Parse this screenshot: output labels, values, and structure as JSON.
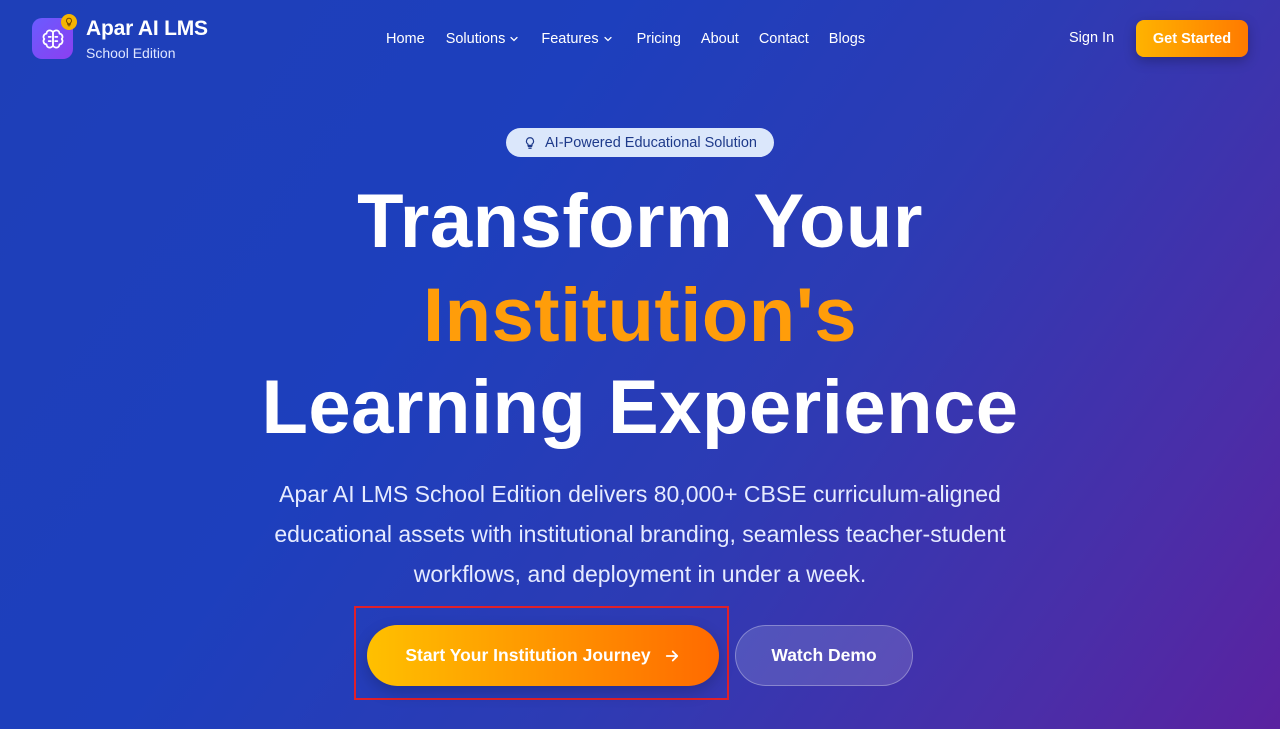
{
  "brand": {
    "title": "Apar AI LMS",
    "subtitle": "School Edition",
    "logo_icon": "brain-icon",
    "badge_icon": "bulb-icon"
  },
  "nav": {
    "items": [
      {
        "label": "Home",
        "has_dropdown": false
      },
      {
        "label": "Solutions",
        "has_dropdown": true
      },
      {
        "label": "Features",
        "has_dropdown": true
      },
      {
        "label": "Pricing",
        "has_dropdown": false
      },
      {
        "label": "About",
        "has_dropdown": false
      },
      {
        "label": "Contact",
        "has_dropdown": false
      },
      {
        "label": "Blogs",
        "has_dropdown": false
      }
    ],
    "sign_in": "Sign In",
    "get_started": "Get Started"
  },
  "hero": {
    "pill_text": "AI-Powered Educational Solution",
    "headline_1": "Transform Your",
    "headline_2": "Institution's",
    "headline_3": "Learning Experience",
    "description_line_1": "Apar AI LMS School Edition delivers 80,000+ CBSE curriculum-aligned",
    "description_line_2": "educational assets with institutional branding, seamless teacher-student",
    "description_line_3": "workflows, and deployment in under a week.",
    "cta_primary": "Start Your Institution Journey",
    "cta_secondary": "Watch Demo"
  },
  "colors": {
    "accent_orange": "#ff9d0a",
    "background_blue": "#1e3fb8",
    "background_purple": "#5a22a0",
    "pill_bg": "#dbe7fb",
    "highlight_frame": "#e0202a"
  }
}
